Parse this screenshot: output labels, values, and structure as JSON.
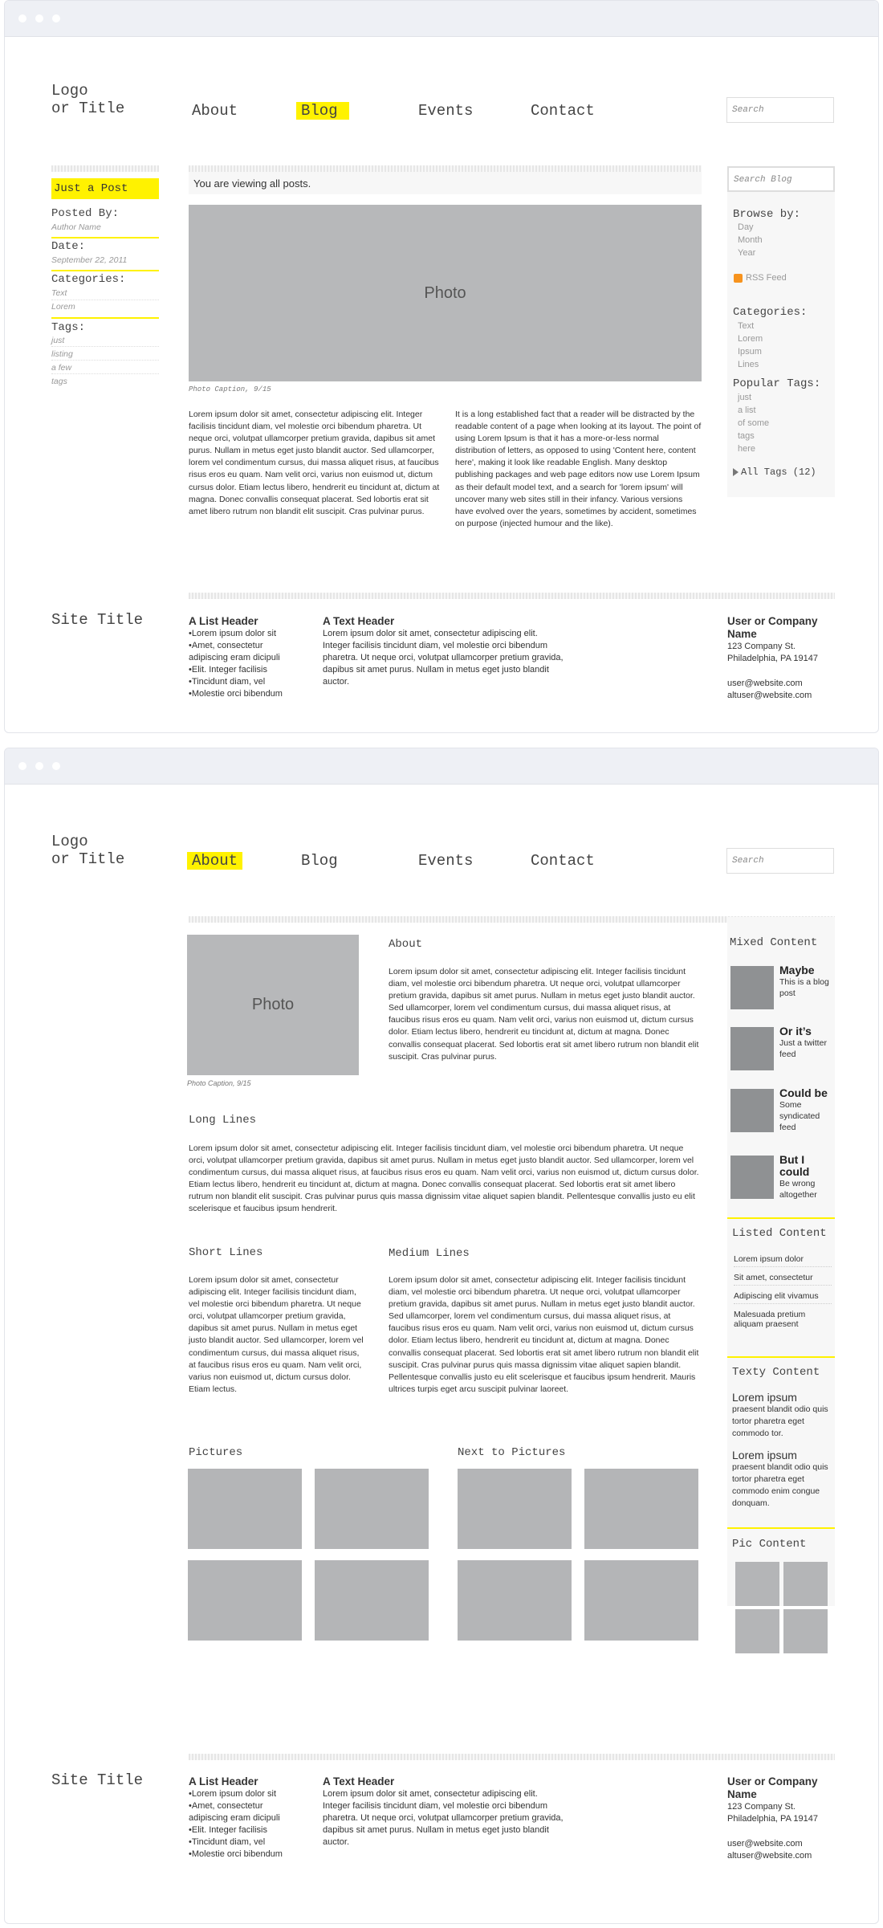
{
  "logo": [
    "Logo",
    "or Title"
  ],
  "search_placeholder": "Search",
  "nav": [
    "About",
    "Blog",
    "Events",
    "Contact"
  ],
  "blog": {
    "post_title": "Just a Post",
    "posted_by_label": "Posted By:",
    "author": "Author Name",
    "date_label": "Date:",
    "date": "September 22, 2011",
    "categories_label": "Categories:",
    "categories": [
      "Text",
      "Lorem"
    ],
    "tags_label": "Tags:",
    "tags": [
      "just",
      "listing",
      "a few",
      "tags"
    ],
    "viewing": "You are viewing all posts.",
    "photo": "Photo",
    "caption": "Photo Caption, 9/15",
    "col1": "Lorem ipsum dolor sit amet, consectetur adipiscing elit. Integer facilisis tincidunt diam, vel molestie orci bibendum pharetra. Ut neque orci, volutpat ullamcorper pretium gravida, dapibus sit amet purus. Nullam in metus eget justo blandit auctor. Sed ullamcorper, lorem vel condimentum cursus, dui massa aliquet risus, at faucibus risus eros eu quam. Nam velit orci, varius non euismod ut, dictum cursus dolor. Etiam lectus libero, hendrerit eu tincidunt at, dictum at magna. Donec convallis consequat placerat. Sed lobortis erat sit amet libero rutrum non blandit elit suscipit. Cras pulvinar purus.",
    "col2": "It is a long established fact that a reader will be distracted by the readable content of a page when looking at its layout. The point of using Lorem Ipsum is that it has a more-or-less normal distribution of letters, as opposed to using 'Content here, content here', making it look like readable English. Many desktop publishing packages and web page editors now use Lorem Ipsum as their default model text, and a search for 'lorem ipsum' will uncover many web sites still in their infancy. Various versions have evolved over the years, sometimes by accident, sometimes on purpose (injected humour and the like).",
    "search_blog": "Search Blog",
    "browse_label": "Browse by:",
    "browse": [
      "Day",
      "Month",
      "Year"
    ],
    "rss": "RSS Feed",
    "side_categories_label": "Categories:",
    "side_categories": [
      "Text",
      "Lorem",
      "Ipsum",
      "Lines"
    ],
    "popular_label": "Popular Tags:",
    "popular": [
      "just",
      "a list",
      "of some",
      "tags",
      "here"
    ],
    "all_tags": "All Tags (12)"
  },
  "footer": {
    "site_title": "Site Title",
    "list_header": "A List Header",
    "list": [
      "•Lorem ipsum dolor sit",
      "•Amet, consectetur",
      "adipiscing eram dicipuli",
      "•Elit. Integer facilisis",
      "•Tincidunt diam, vel",
      "•Molestie orci bibendum"
    ],
    "text_header": "A Text Header",
    "text": "Lorem ipsum dolor sit amet, consectetur adipiscing elit. Integer facilisis tincidunt diam, vel molestie orci bibendum pharetra. Ut neque orci, volutpat ullamcorper pretium gravida, dapibus sit amet purus. Nullam in metus eget justo blandit auctor.",
    "company": [
      "User or Company",
      "Name"
    ],
    "address": [
      "123 Company St.",
      "Philadelphia, PA 19147"
    ],
    "emails": [
      "user@website.com",
      "altuser@website.com"
    ]
  },
  "about": {
    "photo": "Photo",
    "caption": "Photo Caption, 9/15",
    "title": "About",
    "intro": "Lorem ipsum dolor sit amet, consectetur adipiscing elit. Integer facilisis tincidunt diam, vel molestie orci bibendum pharetra. Ut neque orci, volutpat ullamcorper pretium gravida, dapibus sit amet purus. Nullam in metus eget justo blandit auctor. Sed ullamcorper, lorem vel condimentum cursus, dui massa aliquet risus, at faucibus risus eros eu quam. Nam velit orci, varius non euismod ut, dictum cursus dolor. Etiam lectus libero, hendrerit eu tincidunt at, dictum at magna. Donec convallis consequat placerat. Sed lobortis erat sit amet libero rutrum non blandit elit suscipit. Cras pulvinar purus.",
    "long_title": "Long Lines",
    "long": "Lorem ipsum dolor sit amet, consectetur adipiscing elit. Integer facilisis tincidunt diam, vel molestie orci bibendum pharetra. Ut neque orci, volutpat ullamcorper pretium gravida, dapibus sit amet purus. Nullam in metus eget justo blandit auctor. Sed ullamcorper, lorem vel condimentum cursus, dui massa aliquet risus, at faucibus risus eros eu quam. Nam velit orci, varius non euismod ut, dictum cursus dolor. Etiam lectus libero, hendrerit eu tincidunt at, dictum at magna. Donec convallis consequat placerat. Sed lobortis erat sit amet libero rutrum non blandit elit suscipit. Cras pulvinar purus quis massa dignissim vitae aliquet sapien blandit. Pellentesque convallis justo eu elit scelerisque et faucibus ipsum hendrerit.",
    "short_title": "Short Lines",
    "short": "Lorem ipsum dolor sit amet, consectetur adipiscing elit. Integer facilisis tincidunt diam, vel molestie orci bibendum pharetra. Ut neque orci, volutpat ullamcorper pretium gravida, dapibus sit amet purus. Nullam in metus eget justo blandit auctor. Sed ullamcorper, lorem vel condimentum cursus, dui massa aliquet risus, at faucibus risus eros eu quam. Nam velit orci, varius non euismod ut, dictum cursus dolor. Etiam lectus.",
    "medium_title": "Medium Lines",
    "medium": "Lorem ipsum dolor sit amet, consectetur adipiscing elit. Integer facilisis tincidunt diam, vel molestie orci bibendum pharetra. Ut neque orci, volutpat ullamcorper pretium gravida, dapibus sit amet purus. Nullam in metus eget justo blandit auctor. Sed ullamcorper, lorem vel condimentum cursus, dui massa aliquet risus, at faucibus risus eros eu quam. Nam velit orci, varius non euismod ut, dictum cursus dolor. Etiam lectus libero, hendrerit eu tincidunt at, dictum at magna. Donec convallis consequat placerat. Sed lobortis erat sit amet libero rutrum non blandit elit suscipit. Cras pulvinar purus quis massa dignissim vitae aliquet sapien blandit. Pellentesque convallis justo eu elit scelerisque et faucibus ipsum hendrerit. Mauris ultrices turpis eget arcu suscipit pulvinar laoreet.",
    "pictures_title": "Pictures",
    "next_title": "Next to Pictures",
    "mixed_label": "Mixed Content",
    "mixed": [
      {
        "title": "Maybe",
        "text": "This is a blog post"
      },
      {
        "title": "Or it’s",
        "text": "Just a twitter feed"
      },
      {
        "title": "Could be",
        "text": "Some syndicated feed"
      },
      {
        "title": "But I could",
        "text": "Be wrong altogether"
      }
    ],
    "listed_label": "Listed Content",
    "listed": [
      "Lorem ipsum dolor",
      "Sit amet, consectetur",
      "Adipiscing elit vivamus",
      "Malesuada pretium aliquam praesent"
    ],
    "texty_label": "Texty Content",
    "texty": [
      {
        "title": "Lorem ipsum",
        "text": "praesent blandit odio quis tortor pharetra eget commodo tor."
      },
      {
        "title": "Lorem ipsum",
        "text": "praesent blandit odio quis tortor pharetra eget commodo enim congue donquam."
      }
    ],
    "pic_label": "Pic Content"
  },
  "colors": {
    "highlight": "#fff200",
    "placeholder": "#b4b5b7"
  }
}
